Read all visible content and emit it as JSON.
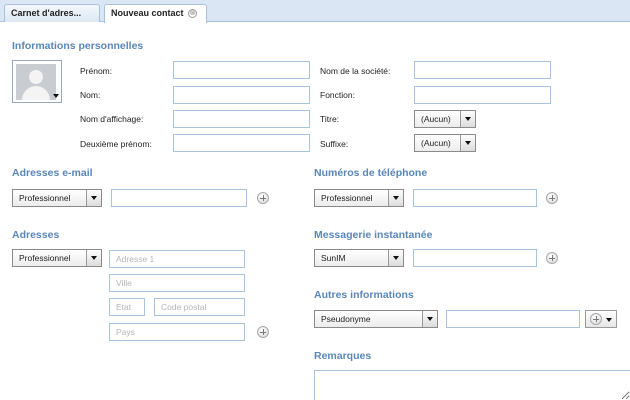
{
  "tabs": [
    {
      "label": "Carnet d'adres..."
    },
    {
      "label": "Nouveau contact",
      "close_glyph": "⊗"
    }
  ],
  "personal": {
    "title": "Informations personnelles",
    "first_name_label": "Prénom:",
    "last_name_label": "Nom:",
    "display_name_label": "Nom d'affichage:",
    "middle_name_label": "Deuxième prénom:",
    "company_label": "Nom de la société:",
    "job_title_label": "Fonction:",
    "title_label": "Titre:",
    "title_value": "(Aucun)",
    "suffix_label": "Suffixe:",
    "suffix_value": "(Aucun)"
  },
  "email": {
    "title": "Adresses e-mail",
    "type_value": "Professionnel"
  },
  "phone": {
    "title": "Numéros de téléphone",
    "type_value": "Professionnel"
  },
  "addresses": {
    "title": "Adresses",
    "type_value": "Professionnel",
    "street_placeholder": "Adresse 1",
    "city_placeholder": "Ville",
    "state_placeholder": "Etat",
    "postal_placeholder": "Code postal",
    "country_placeholder": "Pays"
  },
  "im": {
    "title": "Messagerie instantanée",
    "type_value": "SunIM"
  },
  "other": {
    "title": "Autres informations",
    "type_value": "Pseudonyme"
  },
  "notes": {
    "title": "Remarques"
  },
  "icons": {
    "add": "plus-circle-icon",
    "dropdown": "triangle-down-icon",
    "avatar": "person-silhouette-icon"
  },
  "colors": {
    "section_title": "#5a86b8",
    "field_border": "#a9c4de",
    "tabbar_bg": "#dae6f3"
  }
}
